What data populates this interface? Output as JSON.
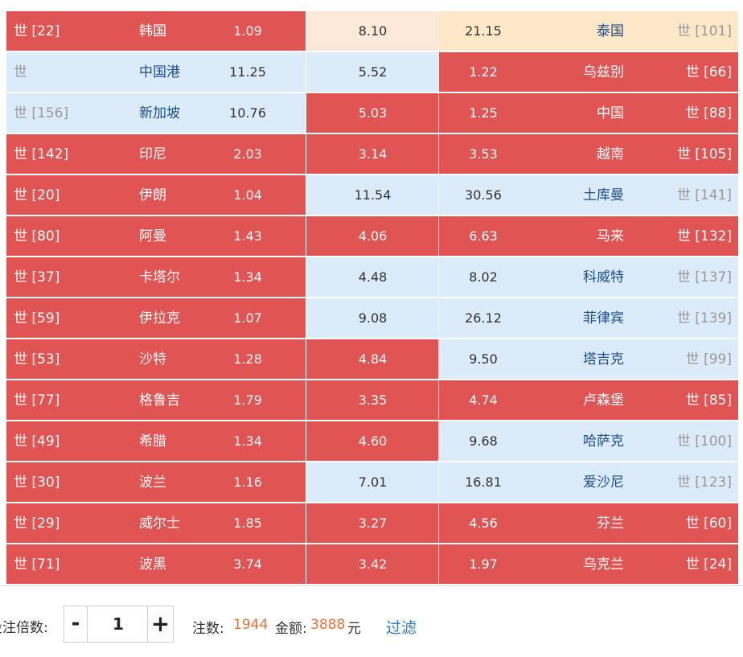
{
  "rows": [
    {
      "l_rank": "世 [22]",
      "l_name": "韩国",
      "l_odds": "1.09",
      "draw": "8.10",
      "r_odds": "21.15",
      "r_name": "泰国",
      "r_rank": "世 [101]",
      "l_bg": "red",
      "d_bg": "peach",
      "r_bg": "cream"
    },
    {
      "l_rank": "世",
      "l_name": "中国港",
      "l_odds": "11.25",
      "draw": "5.52",
      "r_odds": "1.22",
      "r_name": "乌兹别",
      "r_rank": "世 [66]",
      "l_bg": "blue",
      "d_bg": "blue",
      "r_bg": "red"
    },
    {
      "l_rank": "世 [156]",
      "l_name": "新加坡",
      "l_odds": "10.76",
      "draw": "5.03",
      "r_odds": "1.25",
      "r_name": "中国",
      "r_rank": "世 [88]",
      "l_bg": "blue",
      "d_bg": "red",
      "r_bg": "red"
    },
    {
      "l_rank": "世 [142]",
      "l_name": "印尼",
      "l_odds": "2.03",
      "draw": "3.14",
      "r_odds": "3.53",
      "r_name": "越南",
      "r_rank": "世 [105]",
      "l_bg": "red",
      "d_bg": "red",
      "r_bg": "red"
    },
    {
      "l_rank": "世 [20]",
      "l_name": "伊朗",
      "l_odds": "1.04",
      "draw": "11.54",
      "r_odds": "30.56",
      "r_name": "土库曼",
      "r_rank": "世 [141]",
      "l_bg": "red",
      "d_bg": "blue",
      "r_bg": "blue"
    },
    {
      "l_rank": "世 [80]",
      "l_name": "阿曼",
      "l_odds": "1.43",
      "draw": "4.06",
      "r_odds": "6.63",
      "r_name": "马来",
      "r_rank": "世 [132]",
      "l_bg": "red",
      "d_bg": "red",
      "r_bg": "red"
    },
    {
      "l_rank": "世 [37]",
      "l_name": "卡塔尔",
      "l_odds": "1.34",
      "draw": "4.48",
      "r_odds": "8.02",
      "r_name": "科威特",
      "r_rank": "世 [137]",
      "l_bg": "red",
      "d_bg": "blue",
      "r_bg": "blue"
    },
    {
      "l_rank": "世 [59]",
      "l_name": "伊拉克",
      "l_odds": "1.07",
      "draw": "9.08",
      "r_odds": "26.12",
      "r_name": "菲律宾",
      "r_rank": "世 [139]",
      "l_bg": "red",
      "d_bg": "blue",
      "r_bg": "blue"
    },
    {
      "l_rank": "世 [53]",
      "l_name": "沙特",
      "l_odds": "1.28",
      "draw": "4.84",
      "r_odds": "9.50",
      "r_name": "塔吉克",
      "r_rank": "世 [99]",
      "l_bg": "red",
      "d_bg": "red",
      "r_bg": "blue"
    },
    {
      "l_rank": "世 [77]",
      "l_name": "格鲁吉",
      "l_odds": "1.79",
      "draw": "3.35",
      "r_odds": "4.74",
      "r_name": "卢森堡",
      "r_rank": "世 [85]",
      "l_bg": "red",
      "d_bg": "red",
      "r_bg": "red"
    },
    {
      "l_rank": "世 [49]",
      "l_name": "希腊",
      "l_odds": "1.34",
      "draw": "4.60",
      "r_odds": "9.68",
      "r_name": "哈萨克",
      "r_rank": "世 [100]",
      "l_bg": "red",
      "d_bg": "red",
      "r_bg": "blue"
    },
    {
      "l_rank": "世 [30]",
      "l_name": "波兰",
      "l_odds": "1.16",
      "draw": "7.01",
      "r_odds": "16.81",
      "r_name": "爱沙尼",
      "r_rank": "世 [123]",
      "l_bg": "red",
      "d_bg": "blue",
      "r_bg": "blue"
    },
    {
      "l_rank": "世 [29]",
      "l_name": "威尔士",
      "l_odds": "1.85",
      "draw": "3.27",
      "r_odds": "4.56",
      "r_name": "芬兰",
      "r_rank": "世 [60]",
      "l_bg": "red",
      "d_bg": "red",
      "r_bg": "red"
    },
    {
      "l_rank": "世 [71]",
      "l_name": "波黑",
      "l_odds": "3.74",
      "draw": "3.42",
      "r_odds": "1.97",
      "r_name": "乌克兰",
      "r_rank": "世 [24]",
      "l_bg": "red",
      "d_bg": "red",
      "r_bg": "red"
    }
  ],
  "footer": {
    "multiplier_label": "投注倍数:",
    "minus": "-",
    "multiplier_value": "1",
    "plus": "+",
    "bets_label": "注数:",
    "bets_value": "1944",
    "amount_label": "金额:",
    "amount_value": "3888",
    "currency": "元",
    "filter_label": "过滤"
  },
  "colors": {
    "red": "#e05453",
    "blue": "#dcebf9",
    "peach": "#fde9da",
    "cream": "#ffe8c8",
    "orange": "#e8703a",
    "link": "#2f79c8"
  }
}
